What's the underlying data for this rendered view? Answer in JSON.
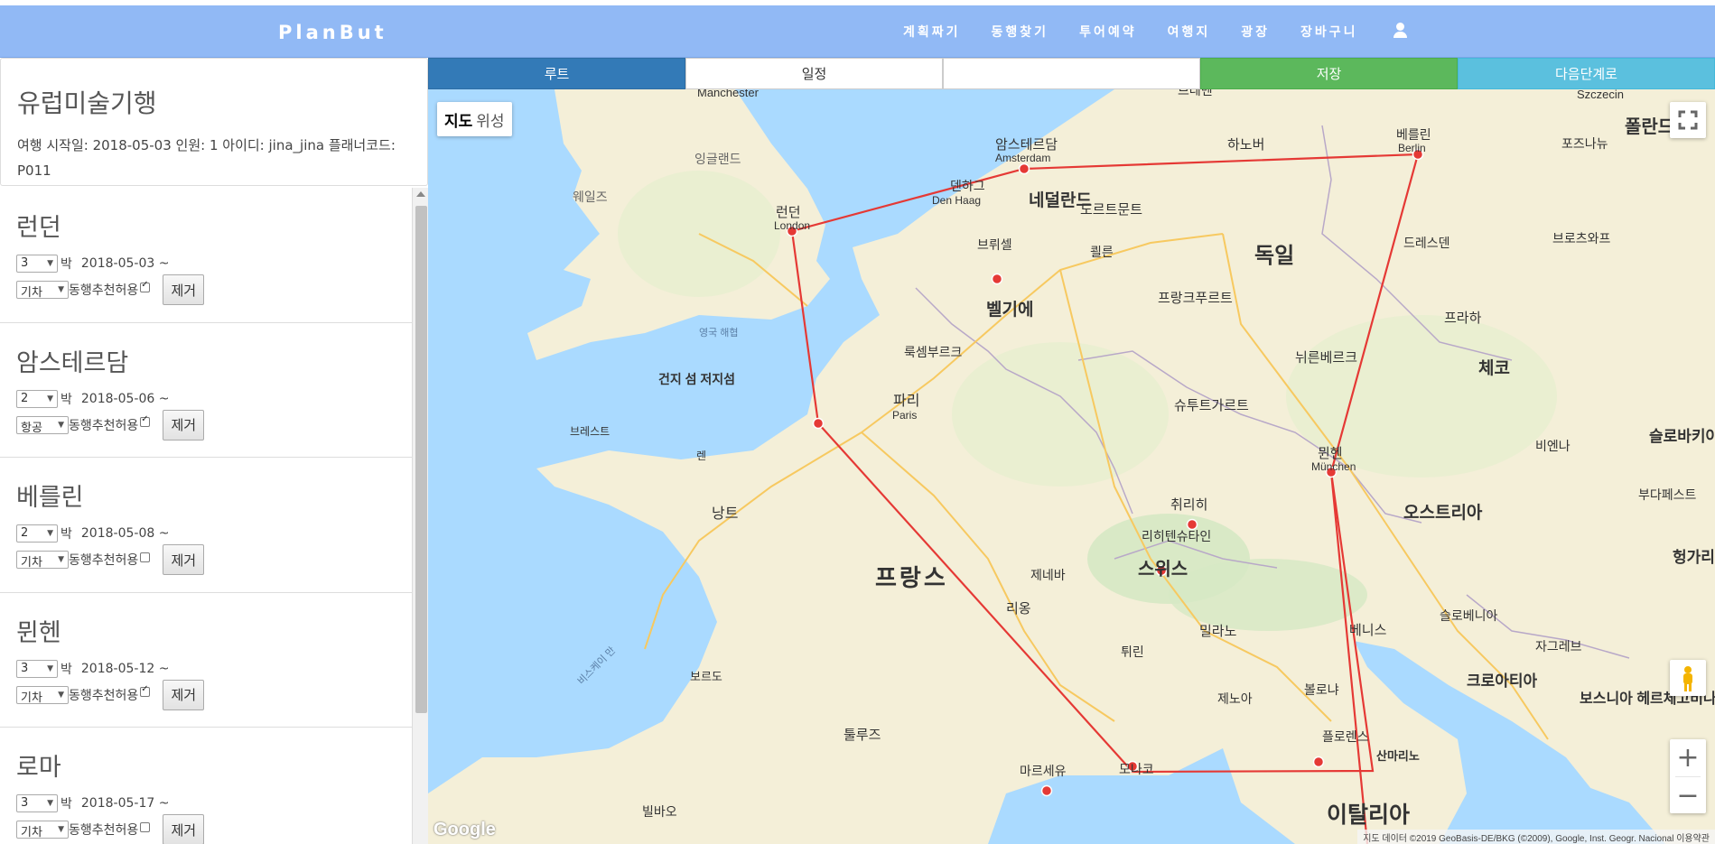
{
  "navbar": {
    "brand": "PlanBut",
    "items": [
      "계획짜기",
      "동행찾기",
      "투어예약",
      "여행지",
      "광장",
      "장바구니"
    ],
    "user_icon": "user-icon",
    "bg_color": "#91b9f5"
  },
  "trip": {
    "title": "유럽미술기행",
    "info": "여행 시작일: 2018-05-03 인원: 1 아이디: jina_jina 플래너코드: P011"
  },
  "cities": [
    {
      "name": "런던",
      "nights": "3",
      "nights_suffix": "박",
      "date": "2018-05-03 ~",
      "transport": "기차",
      "companion_label": "동행추천허용",
      "companion": true,
      "remove": "제거"
    },
    {
      "name": "암스테르담",
      "nights": "2",
      "nights_suffix": "박",
      "date": "2018-05-06 ~",
      "transport": "항공",
      "companion_label": "동행추천허용",
      "companion": true,
      "remove": "제거"
    },
    {
      "name": "베를린",
      "nights": "2",
      "nights_suffix": "박",
      "date": "2018-05-08 ~",
      "transport": "기차",
      "companion_label": "동행추천허용",
      "companion": false,
      "remove": "제거"
    },
    {
      "name": "뮌헨",
      "nights": "3",
      "nights_suffix": "박",
      "date": "2018-05-12 ~",
      "transport": "기차",
      "companion_label": "동행추천허용",
      "companion": true,
      "remove": "제거"
    },
    {
      "name": "로마",
      "nights": "3",
      "nights_suffix": "박",
      "date": "2018-05-17 ~",
      "transport": "기차",
      "companion_label": "동행추천허용",
      "companion": false,
      "remove": "제거"
    }
  ],
  "tabs": {
    "route": "루트",
    "schedule": "일정",
    "blank": "",
    "save": "저장",
    "next": "다음단계로"
  },
  "map": {
    "type_map": "지도",
    "type_satellite": "위성",
    "attribution": "지도 데이터 ©2019 GeoBasis-DE/BKG (©2009), Google, Inst. Geogr. Nacional   이용약관",
    "google_logo": "Google",
    "zoom_in": "+",
    "zoom_out": "−",
    "route_color": "#e53935",
    "labels": {
      "manchester": "Manchester",
      "london": "런던",
      "london_en": "London",
      "england": "잉글랜드",
      "wales": "웨일즈",
      "amsterdam": "암스테르담",
      "amsterdam_en": "Amsterdam",
      "netherlands": "네덜란드",
      "denhaag": "덴하그",
      "denhaag_en": "Den Haag",
      "berlin": "베를린",
      "berlin_en": "Berlin",
      "germany": "독일",
      "belgium": "벨기에",
      "brussel": "브뤼셀",
      "paris": "파리",
      "paris_en": "Paris",
      "france": "프랑스",
      "munich": "뮌헨",
      "munich_en": "München",
      "switzerland": "스위스",
      "zurich": "취리히",
      "austria": "오스트리아",
      "czech": "체코",
      "italy": "이탈리아",
      "florence": "플로렌스",
      "monaco": "모나코",
      "marseille": "마르세유",
      "lyon": "리옹",
      "frankfurt": "프랑크푸르트",
      "hannover": "하노버",
      "bremen": "브레멘",
      "hamburg": "Szczecin",
      "poland": "폴란드",
      "praha": "프라하",
      "milano": "밀라노",
      "venezia": "베니스",
      "nantes": "낭트",
      "bordeaux": "보르도",
      "toulouse": "툴루즈",
      "croatia": "크로아티아",
      "slovenia": "슬로베니아",
      "bosnia": "보스니아 헤르체고비나",
      "luxembourg": "룩셈부르크",
      "liechtenstein": "리히텐슈타인",
      "bretagne": "건지 섬 저지섬",
      "geneva": "제네바",
      "genova": "제노아",
      "torino": "튀린",
      "bologna": "볼로냐",
      "stuttgart": "슈투트가르트",
      "nurnberg": "뉘른베르크",
      "dortmund": "도르트문트",
      "koln": "쾰른",
      "dresden": "드레스덴",
      "wroclaw": "브로츠와프",
      "poznan": "포즈나뉴",
      "budapest": "부다페스트",
      "wien": "비엔나",
      "slovakia": "슬로바키아",
      "hungary": "헝가리",
      "zagreb": "자그레브",
      "sanmarino": "산마리노",
      "bilbao": "빌바오",
      "brest": "브레스트",
      "rennes": "렌",
      "channel": "영국 해협",
      "biscay": "비스케이 만"
    }
  }
}
